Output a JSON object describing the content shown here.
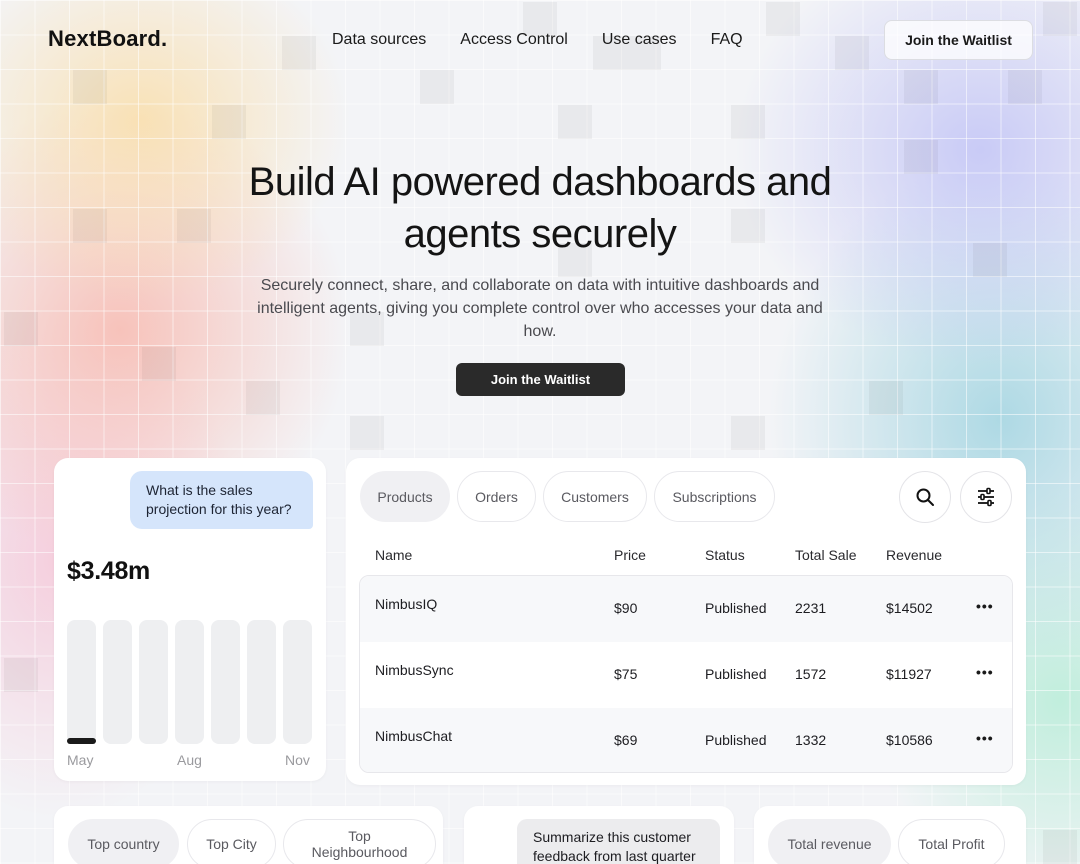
{
  "nav": {
    "logo": "NextBoard.",
    "links": [
      "Data sources",
      "Access Control",
      "Use cases",
      "FAQ"
    ],
    "cta": "Join the Waitlist"
  },
  "hero": {
    "title": "Build AI powered dashboards and agents securely",
    "subtitle": "Securely connect, share, and collaborate on data with intuitive dashboards and intelligent agents, giving you complete control over who accesses your data and how.",
    "cta": "Join the Waitlist"
  },
  "sales_card": {
    "question": "What is the sales projection for this year?",
    "value": "$3.48m",
    "months": [
      "May",
      "Aug",
      "Nov"
    ],
    "bars": [
      0.05,
      0,
      0,
      0,
      0,
      0,
      0
    ]
  },
  "products_card": {
    "tabs": [
      "Products",
      "Orders",
      "Customers",
      "Subscriptions"
    ],
    "columns": [
      "Name",
      "Price",
      "Status",
      "Total Sale",
      "Revenue"
    ],
    "rows": [
      {
        "name": "NimbusIQ",
        "price": "$90",
        "status": "Published",
        "total_sale": "2231",
        "revenue": "$14502"
      },
      {
        "name": "NimbusSync",
        "price": "$75",
        "status": "Published",
        "total_sale": "1572",
        "revenue": "$11927"
      },
      {
        "name": "NimbusChat",
        "price": "$69",
        "status": "Published",
        "total_sale": "1332",
        "revenue": "$10586"
      }
    ],
    "more_glyph": "•••"
  },
  "location_card": {
    "tabs": [
      "Top country",
      "Top City",
      "Top Neighbourhood"
    ]
  },
  "feedback_card": {
    "prompt": "Summarize this customer feedback from last quarter"
  },
  "totals_card": {
    "tabs": [
      "Total revenue",
      "Total Profit"
    ]
  },
  "colors": {
    "accent_dark": "#2a2a2a",
    "chat_bubble": "#d5e5fb",
    "active_tab": "#f0f0f3"
  }
}
